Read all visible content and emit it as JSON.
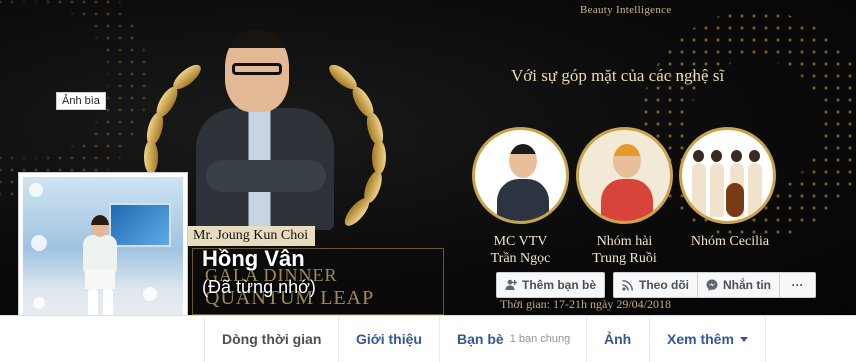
{
  "cover": {
    "label": "Ảnh bìa",
    "brand": "Beauty Intelligence",
    "headline": "Với sự góp mặt của các nghệ sĩ",
    "caption": "Mr. Joung Kun Choi",
    "gala_line1": "GALA DINNER",
    "gala_line2": "QUANTUM LEAP",
    "event_time": "Thời gian: 17-21h ngày 29/04/2018",
    "guests": [
      {
        "line1": "MC VTV",
        "line2": "Trần Ngọc"
      },
      {
        "line1": "Nhóm hài",
        "line2": "Trung Ruồi"
      },
      {
        "line1": "Nhóm Cecilia",
        "line2": ""
      }
    ]
  },
  "profile": {
    "name": "Hồng Vân",
    "alternate_name": "(Đã từng nhớ)"
  },
  "actions": {
    "add_friend": "Thêm bạn bè",
    "follow": "Theo dõi",
    "message": "Nhắn tin",
    "more": "···"
  },
  "tabs": {
    "timeline": "Dòng thời gian",
    "about": "Giới thiệu",
    "friends": "Bạn bè",
    "friends_sub": "1 bạn chung",
    "photos": "Ảnh",
    "more": "Xem thêm"
  },
  "colors": {
    "link_blue": "#365899",
    "gold": "#c9a44b",
    "bg": "#e9ebee"
  }
}
